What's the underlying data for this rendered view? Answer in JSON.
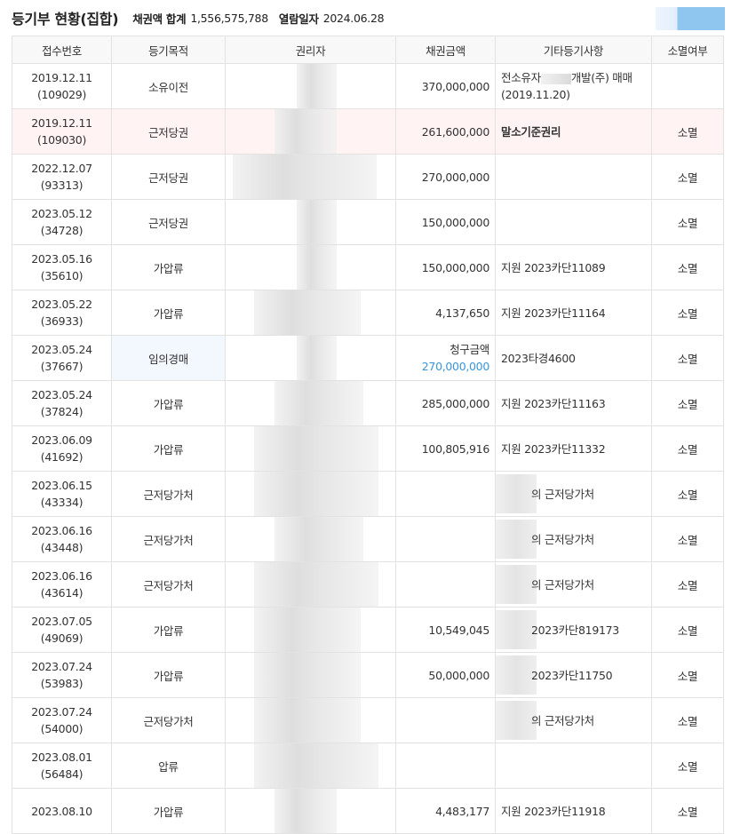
{
  "header": {
    "title": "등기부 현황(집합)",
    "claim_total_label": "채권액 합계",
    "claim_total_value": "1,556,575,788",
    "view_date_label": "열람일자",
    "view_date_value": "2024.06.28"
  },
  "columns": [
    "접수번호",
    "등기목적",
    "권리자",
    "채권금액",
    "기타등기사항",
    "소멸여부"
  ],
  "rows": [
    {
      "date": "2019.12.11",
      "no": "(109029)",
      "purpose": "소유이전",
      "amount": "",
      "misc_before": "전소유자",
      "misc_after": "개발(주) 매매",
      "misc2": "(2019.11.20)",
      "ext": "",
      "holder_blur": [
        80,
        45
      ]
    },
    {
      "date": "2019.12.11",
      "no": "(109030)",
      "purpose": "근저당권",
      "amount": "261,600,000",
      "misc": "말소기준권리",
      "ext": "소멸",
      "holder_blur": [
        55,
        70
      ]
    },
    {
      "date": "2022.12.07",
      "no": "(93313)",
      "purpose": "근저당권",
      "amount": "270,000,000",
      "misc": "",
      "ext": "소멸",
      "holder_blur": [
        8,
        162
      ]
    },
    {
      "date": "2023.05.12",
      "no": "(34728)",
      "purpose": "근저당권",
      "amount": "150,000,000",
      "misc": "",
      "ext": "소멸",
      "holder_blur": [
        80,
        45
      ]
    },
    {
      "date": "2023.05.16",
      "no": "(35610)",
      "purpose": "가압류",
      "amount": "150,000,000",
      "misc": "지원 2023카단11089",
      "ext": "소멸",
      "holder_blur": [
        80,
        45
      ]
    },
    {
      "date": "2023.05.22",
      "no": "(36933)",
      "purpose": "가압류",
      "amount": "4,137,650",
      "misc": "지원 2023카단11164",
      "ext": "소멸",
      "holder_blur": [
        32,
        120
      ]
    },
    {
      "date": "2023.05.24",
      "no": "(37667)",
      "purpose": "임의경매",
      "amount_label": "청구금액",
      "amount": "270,000,000",
      "misc": "2023타경4600",
      "ext": "소멸",
      "holder_blur": [
        80,
        45
      ]
    },
    {
      "date": "2023.05.24",
      "no": "(37824)",
      "purpose": "가압류",
      "amount": "285,000,000",
      "misc": "지원 2023카단11163",
      "ext": "소멸",
      "holder_blur": [
        55,
        100
      ]
    },
    {
      "date": "2023.06.09",
      "no": "(41692)",
      "purpose": "가압류",
      "amount": "100,805,916",
      "misc": "지원 2023카단11332",
      "ext": "소멸",
      "holder_blur": [
        32,
        140
      ]
    },
    {
      "date": "2023.06.15",
      "no": "(43334)",
      "purpose": "근저당가처",
      "amount": "",
      "misc": "의 근저당가처",
      "ext": "소멸",
      "holder_blur": [
        32,
        140
      ]
    },
    {
      "date": "2023.06.16",
      "no": "(43448)",
      "purpose": "근저당가처",
      "amount": "",
      "misc": "의 근저당가처",
      "ext": "소멸",
      "holder_blur": [
        55,
        100
      ]
    },
    {
      "date": "2023.06.16",
      "no": "(43614)",
      "purpose": "근저당가처",
      "amount": "",
      "misc": "의 근저당가처",
      "ext": "소멸",
      "holder_blur": [
        32,
        140
      ]
    },
    {
      "date": "2023.07.05",
      "no": "(49069)",
      "purpose": "가압류",
      "amount": "10,549,045",
      "misc": "2023카단819173",
      "ext": "소멸",
      "holder_blur": [
        32,
        120
      ]
    },
    {
      "date": "2023.07.24",
      "no": "(53983)",
      "purpose": "가압류",
      "amount": "50,000,000",
      "misc": "2023카단11750",
      "ext": "소멸",
      "holder_blur": [
        32,
        120
      ]
    },
    {
      "date": "2023.07.24",
      "no": "(54000)",
      "purpose": "근저당가처",
      "amount": "",
      "misc": "의 근저당가처",
      "ext": "소멸",
      "holder_blur": [
        32,
        120
      ]
    },
    {
      "date": "2023.08.01",
      "no": "(56484)",
      "purpose": "압류",
      "amount": "",
      "misc": "",
      "ext": "소멸",
      "holder_blur": [
        32,
        140
      ]
    },
    {
      "date": "2023.08.10",
      "no": "",
      "purpose": "가압류",
      "amount": "4,483,177",
      "misc": "지원 2023카단11918",
      "ext": "소멸",
      "holder_blur": [
        55,
        70
      ]
    }
  ],
  "first_row_amount": "370,000,000"
}
